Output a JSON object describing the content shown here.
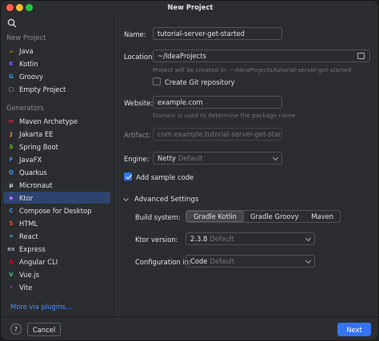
{
  "window": {
    "title": "New Project"
  },
  "sidebar": {
    "search_icon": "search-icon",
    "section_new": "New Project",
    "new_items": [
      {
        "label": "Java",
        "icon": "java-icon",
        "color": "#e76f00",
        "glyph": "☕"
      },
      {
        "label": "Kotlin",
        "icon": "kotlin-icon",
        "color": "#7f52ff",
        "glyph": "K"
      },
      {
        "label": "Groovy",
        "icon": "groovy-icon",
        "color": "#4298b8",
        "glyph": "G"
      },
      {
        "label": "Empty Project",
        "icon": "empty-project-icon",
        "color": "#a8adbd",
        "glyph": "▢"
      }
    ],
    "section_generators": "Generators",
    "generators": [
      {
        "label": "Maven Archetype",
        "icon": "maven-icon",
        "color": "#c71a36",
        "glyph": "m"
      },
      {
        "label": "Jakarta EE",
        "icon": "jakarta-icon",
        "color": "#f0a030",
        "glyph": "J"
      },
      {
        "label": "Spring Boot",
        "icon": "spring-icon",
        "color": "#6db33f",
        "glyph": "S"
      },
      {
        "label": "JavaFX",
        "icon": "javafx-icon",
        "color": "#4a90d9",
        "glyph": "F"
      },
      {
        "label": "Quarkus",
        "icon": "quarkus-icon",
        "color": "#4695eb",
        "glyph": "Q"
      },
      {
        "label": "Micronaut",
        "icon": "micronaut-icon",
        "color": "#dfe1e5",
        "glyph": "μ"
      },
      {
        "label": "Ktor",
        "icon": "ktor-icon",
        "color": "#b66cff",
        "glyph": "◆"
      },
      {
        "label": "Compose for Desktop",
        "icon": "compose-icon",
        "color": "#4285f4",
        "glyph": "C"
      },
      {
        "label": "HTML",
        "icon": "html-icon",
        "color": "#e44d26",
        "glyph": "5"
      },
      {
        "label": "React",
        "icon": "react-icon",
        "color": "#61dafb",
        "glyph": "⚛"
      },
      {
        "label": "Express",
        "icon": "express-icon",
        "color": "#a8adbd",
        "glyph": "ex"
      },
      {
        "label": "Angular CLI",
        "icon": "angular-icon",
        "color": "#dd0031",
        "glyph": "A"
      },
      {
        "label": "Vue.js",
        "icon": "vue-icon",
        "color": "#41b883",
        "glyph": "V"
      },
      {
        "label": "Vite",
        "icon": "vite-icon",
        "color": "#bd34fe",
        "glyph": "⚡"
      }
    ],
    "selected": "Ktor",
    "plugins_link": "More via plugins..."
  },
  "form": {
    "name_label": "Name:",
    "name_value": "tutorial-server-get-started",
    "location_label": "Location:",
    "location_value": "~/IdeaProjects",
    "location_hint": "Project will be created in: ~/IdeaProjects/tutorial-server-get-started",
    "git_label": "Create Git repository",
    "git_checked": false,
    "website_label": "Website:",
    "website_value": "example.com",
    "website_hint": "Domain is used to determine the package name",
    "artifact_label": "Artifact:",
    "artifact_value": "com.example.tutorial-server-get-started",
    "engine_label": "Engine:",
    "engine_value": "Netty",
    "engine_sub": "Default",
    "sample_label": "Add sample code",
    "sample_checked": true,
    "advanced_label": "Advanced Settings",
    "build_label": "Build system:",
    "build_options": [
      "Gradle Kotlin",
      "Gradle Groovy",
      "Maven"
    ],
    "build_selected": "Gradle Kotlin",
    "ktor_label": "Ktor version:",
    "ktor_value": "2.3.8",
    "ktor_sub": "Default",
    "config_label": "Configuration in:",
    "config_value": "Code",
    "config_sub": "Default"
  },
  "footer": {
    "help": "?",
    "cancel": "Cancel",
    "next": "Next"
  },
  "colors": {
    "accent": "#3574f0",
    "selection": "#2e436e",
    "link": "#548af7"
  }
}
